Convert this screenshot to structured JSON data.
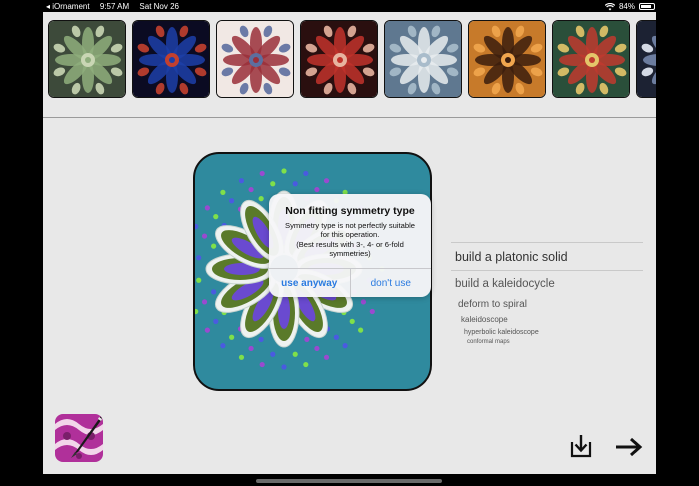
{
  "status_bar": {
    "app_back": "◂ iOrnament",
    "time": "9:57 AM",
    "date": "Sat Nov 26",
    "battery": "84%",
    "battery_level": 0.84,
    "wifi_icon": "wifi-icon",
    "battery_icon": "battery-icon"
  },
  "gallery": {
    "thumbnails": [
      {
        "name": "ornament-1",
        "colors": [
          "#3d4a3a",
          "#8fae7d",
          "#c9d6b4"
        ]
      },
      {
        "name": "ornament-2",
        "colors": [
          "#0b0b22",
          "#1d3fa8",
          "#c2402f"
        ]
      },
      {
        "name": "ornament-3",
        "colors": [
          "#f1e8e4",
          "#9a2f3a",
          "#5c6e9f"
        ]
      },
      {
        "name": "ornament-4",
        "colors": [
          "#2a0f0f",
          "#c1322b",
          "#e7b4a0"
        ]
      },
      {
        "name": "ornament-5",
        "colors": [
          "#5f7890",
          "#e8ecef",
          "#a9bccb"
        ]
      },
      {
        "name": "ornament-6",
        "colors": [
          "#c77a2a",
          "#3b1d0d",
          "#f1a64e"
        ]
      },
      {
        "name": "ornament-7",
        "colors": [
          "#2a4f3a",
          "#c03a2f",
          "#e4c56a"
        ]
      },
      {
        "name": "ornament-8",
        "colors": [
          "#1c2233",
          "#7a8db3",
          "#e8edf7"
        ]
      }
    ]
  },
  "menu": {
    "items": [
      {
        "label": "build a platonic solid",
        "size": 12.5
      },
      {
        "label": "build a kaleidocycle",
        "size": 11.5
      },
      {
        "label": "deform to spiral",
        "size": 10
      },
      {
        "label": "kaleidoscope",
        "size": 8
      },
      {
        "label": "hyperbolic kaleidoscope",
        "size": 7
      },
      {
        "label": "conformal maps",
        "size": 6
      }
    ]
  },
  "dialog": {
    "title": "Non fitting symmetry type",
    "message_line1": "Symmetry type is not perfectly suitable",
    "message_line2": "for this operation.",
    "message_line3": "(Best results with 3-, 4- or 6-fold",
    "message_line4": "symmetries)",
    "primary_button": "use anyway",
    "secondary_button": "don't use"
  },
  "toolbar": {
    "app_icon": "ornament-app-icon",
    "export_icon": "download-icon",
    "next_icon": "arrow-right-icon"
  },
  "colors": {
    "preview_background": "#2f8a9e",
    "accent": "#2a7ae0",
    "petal_outer": "#5a7a2a",
    "petal_inner": "#6a4ad0",
    "dots": [
      "#7fe04a",
      "#4a5be0",
      "#9a4ad0"
    ]
  }
}
